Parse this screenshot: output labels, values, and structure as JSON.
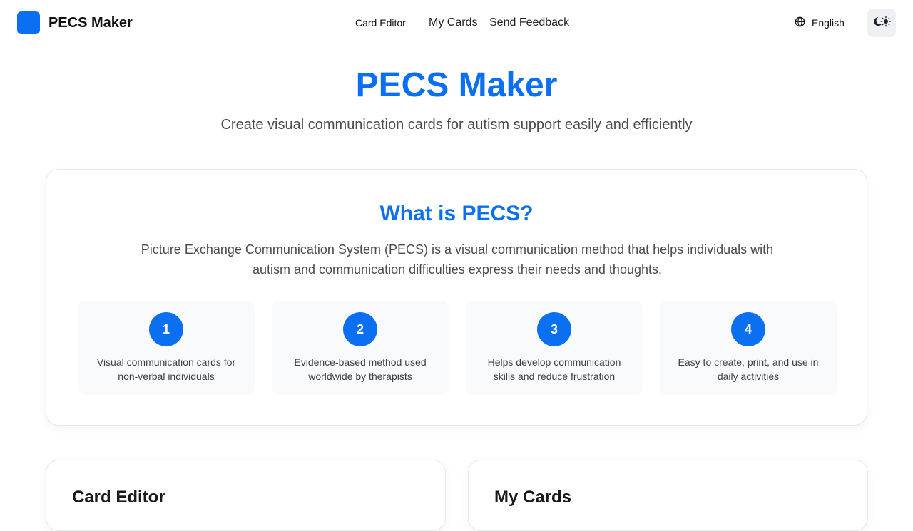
{
  "header": {
    "brand": "PECS Maker",
    "nav": {
      "card_editor": "Card Editor",
      "my_cards": "My Cards",
      "send_feedback": "Send Feedback"
    },
    "language": "English",
    "icons": {
      "logo": "logo-square",
      "language": "globe-icon",
      "theme": "theme-toggle-icon"
    }
  },
  "hero": {
    "title": "PECS Maker",
    "subtitle": "Create visual communication cards for autism support easily and efficiently"
  },
  "info": {
    "title": "What is PECS?",
    "description": "Picture Exchange Communication System (PECS) is a visual communication method that helps individuals with autism and communication difficulties express their needs and thoughts.",
    "features": [
      {
        "number": "1",
        "text": "Visual communication cards for non-verbal individuals"
      },
      {
        "number": "2",
        "text": "Evidence-based method used worldwide by therapists"
      },
      {
        "number": "3",
        "text": "Helps develop communication skills and reduce frustration"
      },
      {
        "number": "4",
        "text": "Easy to create, print, and use in daily activities"
      }
    ]
  },
  "panels": {
    "card_editor_title": "Card Editor",
    "my_cards_title": "My Cards"
  },
  "colors": {
    "accent": "#0a6ff0",
    "text": "#1a1a1a",
    "muted": "#4b4b4b"
  }
}
